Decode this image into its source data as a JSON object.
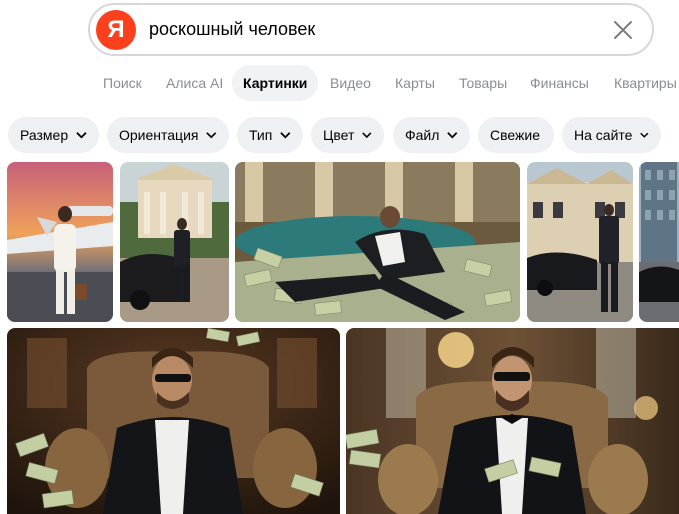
{
  "search": {
    "logo_letter": "Я",
    "query": "роскошный человек"
  },
  "tabs": [
    {
      "label": "Поиск"
    },
    {
      "label": "Алиса AI"
    },
    {
      "label": "Картинки"
    },
    {
      "label": "Видео"
    },
    {
      "label": "Карты"
    },
    {
      "label": "Товары"
    },
    {
      "label": "Финансы"
    },
    {
      "label": "Квартиры"
    }
  ],
  "active_tab": "Картинки",
  "filters": [
    {
      "label": "Размер",
      "dropdown": true
    },
    {
      "label": "Ориентация",
      "dropdown": true
    },
    {
      "label": "Тип",
      "dropdown": true
    },
    {
      "label": "Цвет",
      "dropdown": true
    },
    {
      "label": "Файл",
      "dropdown": true
    },
    {
      "label": "Свежие",
      "dropdown": false
    },
    {
      "label": "На сайте",
      "dropdown": true
    }
  ],
  "results": [
    {
      "subject": "woman in white suit by private jet at sunset"
    },
    {
      "subject": "man in suit by sports car in front of mansion"
    },
    {
      "subject": "man in suit lying on pile of dollar bills by pool"
    },
    {
      "subject": "man in suit next to black car in front of palace"
    },
    {
      "subject": "partially visible city street with car"
    },
    {
      "subject": "man in sunglasses on armchair with dollar bills"
    },
    {
      "subject": "man in tuxedo with sunglasses on armchair holding dollars"
    }
  ],
  "colors": {
    "brand": "#fc3f1d",
    "chip_bg": "#eef0f3",
    "tab_inactive": "#8a8d94",
    "border": "#d6d7db"
  }
}
